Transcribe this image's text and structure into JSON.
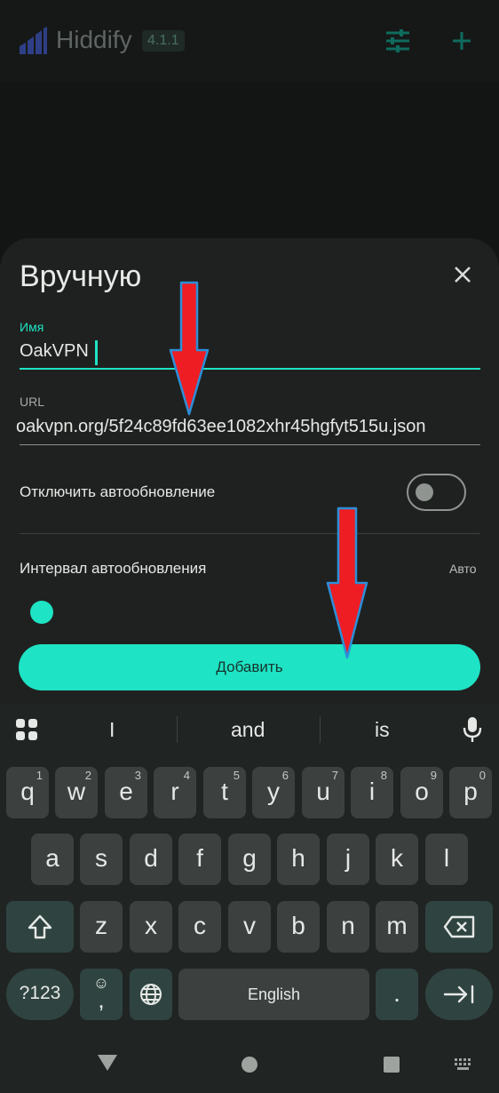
{
  "app": {
    "title": "Hiddify",
    "version": "4.1.1"
  },
  "icons": {
    "logo": "hiddify-logo-icon",
    "filter": "sliders-icon",
    "add": "plus-icon",
    "close": "close-icon",
    "apps": "grid-icon",
    "mic": "mic-icon"
  },
  "sheet": {
    "title": "Вручную",
    "name_label": "Имя",
    "name_value": "OakVPN",
    "url_label": "URL",
    "url_value": "oakvpn.org/5f24c89fd63ee1082xhr45hgfyt515u.json",
    "disable_autoupdate_label": "Отключить автообновление",
    "disable_autoupdate_on": false,
    "interval_label": "Интервал автообновления",
    "interval_value": "Авто",
    "submit_label": "Добавить"
  },
  "keyboard": {
    "suggestions": [
      "I",
      "and",
      "is"
    ],
    "row1": [
      {
        "char": "q",
        "hint": "1"
      },
      {
        "char": "w",
        "hint": "2"
      },
      {
        "char": "e",
        "hint": "3"
      },
      {
        "char": "r",
        "hint": "4"
      },
      {
        "char": "t",
        "hint": "5"
      },
      {
        "char": "y",
        "hint": "6"
      },
      {
        "char": "u",
        "hint": "7"
      },
      {
        "char": "i",
        "hint": "8"
      },
      {
        "char": "o",
        "hint": "9"
      },
      {
        "char": "p",
        "hint": "0"
      }
    ],
    "row2": [
      "a",
      "s",
      "d",
      "f",
      "g",
      "h",
      "j",
      "k",
      "l"
    ],
    "row3": [
      "z",
      "x",
      "c",
      "v",
      "b",
      "n",
      "m"
    ],
    "symbols_label": "?123",
    "emoji_label": "☺",
    "comma_label": ",",
    "space_label": "English",
    "period_label": "."
  },
  "colors": {
    "accent": "#1ee3c4",
    "sheet_bg": "#1f2120",
    "arrow_fill": "#ee1d23",
    "arrow_outline": "#2b8fd8"
  }
}
